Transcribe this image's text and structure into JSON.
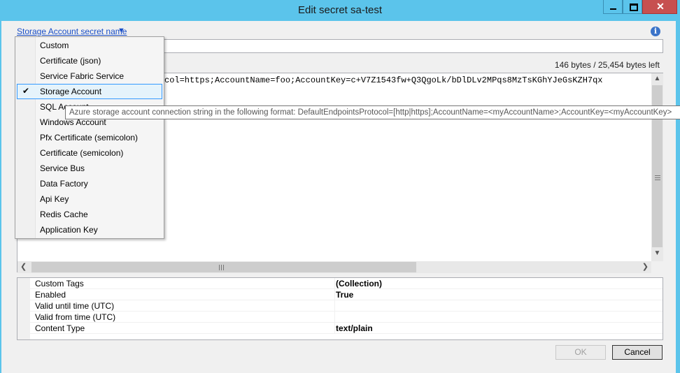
{
  "window": {
    "title": "Edit secret sa-test"
  },
  "secret_name": {
    "label": "Storage Account secret name",
    "value": ""
  },
  "bytes_info": "146 bytes / 25,454 bytes left",
  "editor": {
    "text": "col=https;AccountName=foo;AccountKey=c+V7Z1543fw+Q3QgoLk/bDlDLv2MPqs8MzTsKGhYJeGsKZH7qx"
  },
  "dropdown": {
    "items": [
      {
        "label": "Custom"
      },
      {
        "label": "Certificate (json)"
      },
      {
        "label": "Service Fabric Service"
      },
      {
        "label": "Storage Account",
        "selected": true
      },
      {
        "label": "SQL Account"
      },
      {
        "label": "Windows Account"
      },
      {
        "label": "Pfx Certificate (semicolon)"
      },
      {
        "label": "Certificate (semicolon)"
      },
      {
        "label": "Service Bus"
      },
      {
        "label": "Data Factory"
      },
      {
        "label": "Api Key"
      },
      {
        "label": "Redis Cache"
      },
      {
        "label": "Application Key"
      }
    ]
  },
  "tooltip": "Azure storage account connection string in the following format: DefaultEndpointsProtocol=[http|https];AccountName=<myAccountName>;AccountKey=<myAccountKey>",
  "properties": [
    {
      "name": "Custom Tags",
      "value": "(Collection)"
    },
    {
      "name": "Enabled",
      "value": "True"
    },
    {
      "name": "Valid until time (UTC)",
      "value": ""
    },
    {
      "name": "Valid from time (UTC)",
      "value": ""
    },
    {
      "name": "Content Type",
      "value": "text/plain"
    }
  ],
  "buttons": {
    "ok": "OK",
    "cancel": "Cancel"
  },
  "colors": {
    "titlebar": "#5bc4eb",
    "close": "#c75050",
    "selection_border": "#3399ff"
  }
}
